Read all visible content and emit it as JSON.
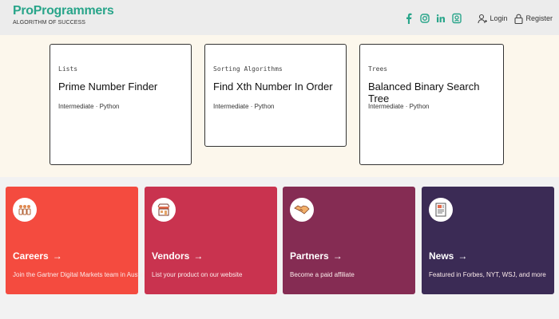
{
  "brand": {
    "name": "ProProgrammers",
    "tagline": "ALGORITHM OF SUCCESS"
  },
  "header": {
    "social": [
      "facebook-icon",
      "instagram-icon",
      "linkedin-icon",
      "badge-icon"
    ],
    "login": "Login",
    "register": "Register"
  },
  "cards": [
    {
      "category": "Lists",
      "title": "Prime Number Finder",
      "meta": "Intermediate · Python"
    },
    {
      "category": "Sorting Algorithms",
      "title": "Find Xth Number In Order",
      "meta": "Intermediate · Python"
    },
    {
      "category": "Trees",
      "title": "Balanced Binary Search Tree",
      "meta": "Intermediate · Python"
    }
  ],
  "tiles": [
    {
      "name": "Careers",
      "arrow": "→",
      "desc": "Join the Gartner Digital Markets team in Austin.",
      "color": "#f44b3f",
      "icon": "people-icon"
    },
    {
      "name": "Vendors",
      "arrow": "→",
      "desc": "List your product on our website",
      "color": "#c9334f",
      "icon": "storefront-icon"
    },
    {
      "name": "Partners",
      "arrow": "→",
      "desc": "Become a paid affiliate",
      "color": "#852c53",
      "icon": "handshake-icon"
    },
    {
      "name": "News",
      "arrow": "→",
      "desc": "Featured in Forbes, NYT, WSJ, and more",
      "color": "#3b2b55",
      "icon": "newspaper-icon"
    }
  ]
}
